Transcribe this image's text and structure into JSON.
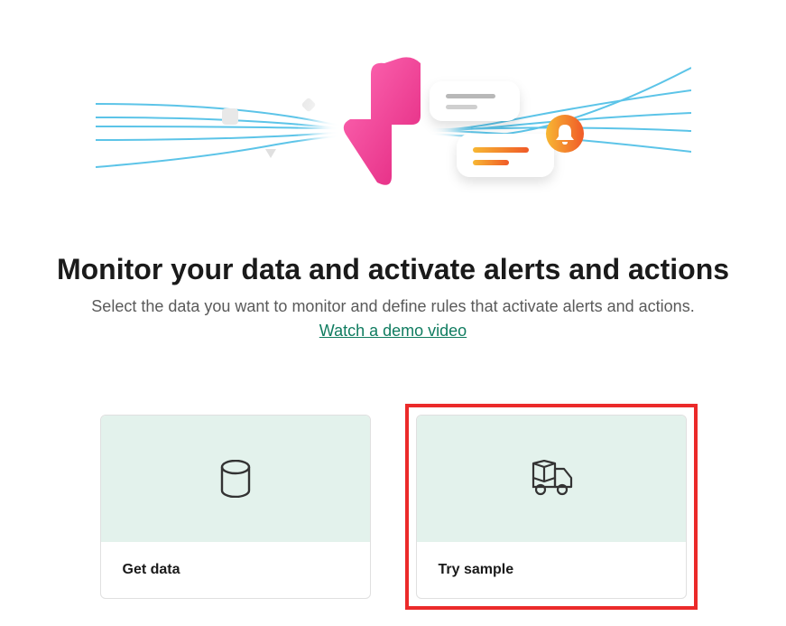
{
  "hero": {
    "heading": "Monitor your data and activate alerts and actions",
    "subheading": "Select the data you want to monitor and define rules that activate alerts and actions.",
    "demo_link_label": "Watch a demo video"
  },
  "cards": {
    "get_data_label": "Get data",
    "try_sample_label": "Try sample"
  },
  "icons": {
    "database": "database-icon",
    "truck": "delivery-truck-icon",
    "lightning": "lightning-bolt-icon",
    "bell": "bell-icon"
  },
  "colors": {
    "accent_green": "#107c60",
    "highlight_red": "#eb2a2a",
    "bolt_pink_light": "#ff5cb0",
    "bolt_pink_dark": "#e2267f",
    "orange": "#f5a623",
    "card_icon_bg": "#e3f2ec"
  }
}
